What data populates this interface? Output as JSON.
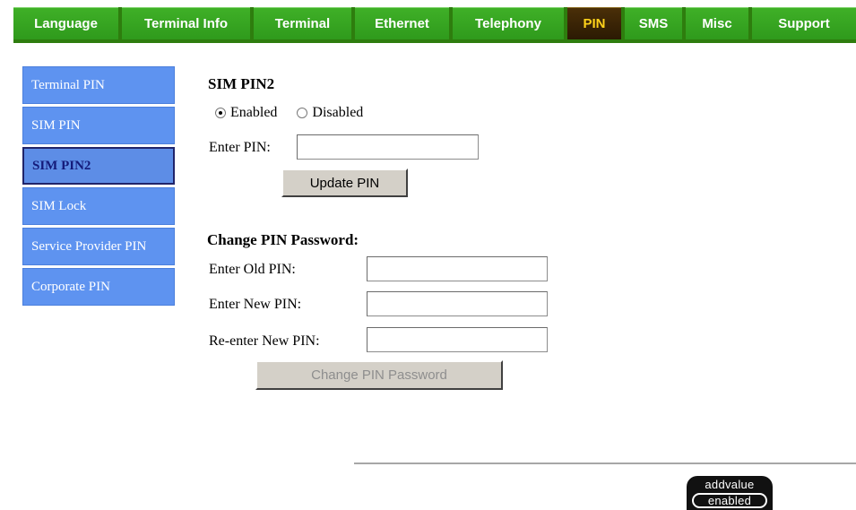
{
  "nav": {
    "tabs": [
      {
        "label": "Language",
        "active": false
      },
      {
        "label": "Terminal Info",
        "active": false
      },
      {
        "label": "Terminal",
        "active": false
      },
      {
        "label": "Ethernet",
        "active": false
      },
      {
        "label": "Telephony",
        "active": false
      },
      {
        "label": "PIN",
        "active": true
      },
      {
        "label": "SMS",
        "active": false
      },
      {
        "label": "Misc",
        "active": false
      },
      {
        "label": "Support",
        "active": false
      }
    ]
  },
  "sidebar": {
    "items": [
      {
        "label": "Terminal PIN",
        "active": false
      },
      {
        "label": "SIM PIN",
        "active": false
      },
      {
        "label": "SIM PIN2",
        "active": true
      },
      {
        "label": "SIM Lock",
        "active": false
      },
      {
        "label": "Service Provider PIN",
        "active": false
      },
      {
        "label": "Corporate PIN",
        "active": false
      }
    ]
  },
  "sim_pin2": {
    "title": "SIM PIN2",
    "enabled_label": "Enabled",
    "disabled_label": "Disabled",
    "selected": "Enabled",
    "enter_pin_label": "Enter PIN:",
    "enter_pin_value": "",
    "update_button": "Update PIN"
  },
  "change_pin": {
    "title": "Change PIN Password:",
    "old_pin_label": "Enter Old PIN:",
    "new_pin_label": "Enter New PIN:",
    "reenter_pin_label": "Re-enter New PIN:",
    "old_pin_value": "",
    "new_pin_value": "",
    "reenter_pin_value": "",
    "submit_button": "Change PIN Password",
    "submit_disabled": true
  },
  "logo": {
    "line1": "addvalue",
    "line2": "enabled"
  },
  "colors": {
    "nav_green": "#2f9a1c",
    "nav_active_bg": "#2b1a03",
    "nav_active_text": "#ffd21a",
    "sidebar_blue": "#5e93f0",
    "sidebar_active_text": "#141a7a"
  }
}
